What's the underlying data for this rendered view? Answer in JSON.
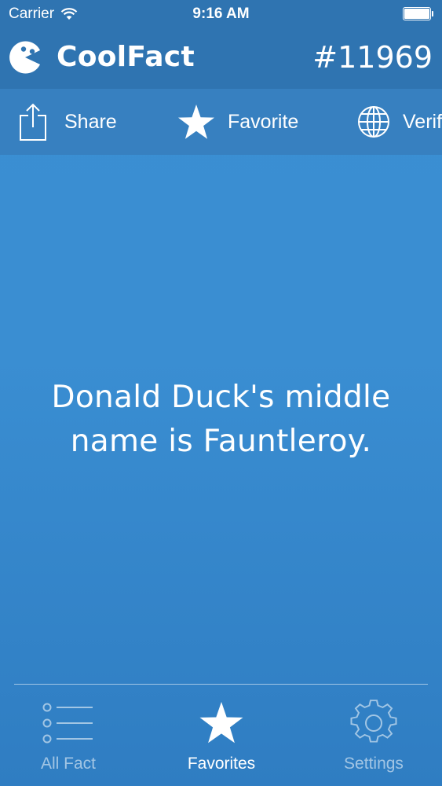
{
  "status_bar": {
    "carrier": "Carrier",
    "time": "9:16 AM"
  },
  "header": {
    "app_name": "CoolFact",
    "fact_number": "#11969",
    "logo_icon": "pacman-face-icon"
  },
  "actions": [
    {
      "label": "Share",
      "icon": "share-icon"
    },
    {
      "label": "Favorite",
      "icon": "star-icon"
    },
    {
      "label": "Verify",
      "icon": "globe-icon"
    }
  ],
  "fact": {
    "text": "Donald Duck's middle name is Fauntleroy."
  },
  "tab_bar": {
    "tabs": [
      {
        "label": "All Fact",
        "icon": "list-icon",
        "active": false
      },
      {
        "label": "Favorites",
        "icon": "star-icon",
        "active": true
      },
      {
        "label": "Settings",
        "icon": "gear-icon",
        "active": false
      }
    ]
  },
  "colors": {
    "header_bg": "#2f74b1",
    "action_bar_bg": "#3780c0",
    "content_bg": "#3a8fd3",
    "text": "#ffffff"
  }
}
